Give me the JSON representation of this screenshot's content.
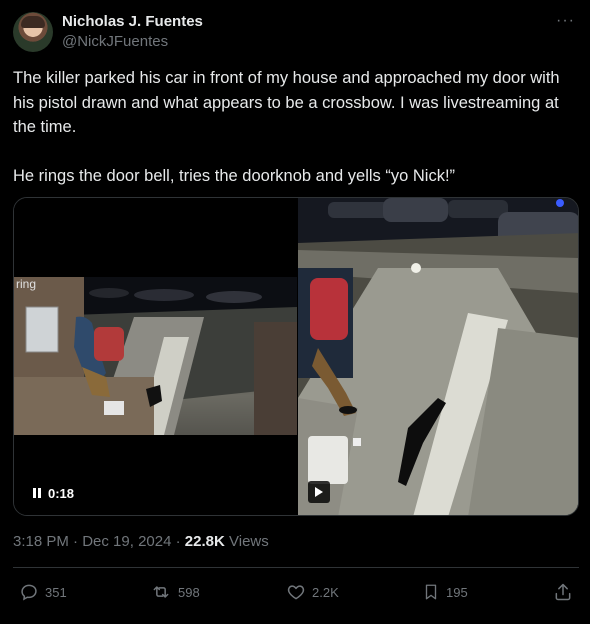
{
  "author": {
    "name": "Nicholas J. Fuentes",
    "handle": "@NickJFuentes",
    "more_icon": "more-dots-icon"
  },
  "tweet": {
    "paragraph_1": "The killer parked his car in front of my house and approached my door with his pistol drawn and what appears to be a crossbow. I was livestreaming at the time.",
    "paragraph_2": "He rings the door bell, tries the doorknob and yells “yo Nick!”"
  },
  "media": {
    "left_video": {
      "watermark": "ring",
      "duration": "0:18",
      "pause_icon": "pause-icon"
    },
    "right_video": {
      "play_icon": "play-icon"
    }
  },
  "meta": {
    "time": "3:18 PM",
    "separator": "·",
    "date": "Dec 19, 2024",
    "views_count": "22.8K",
    "views_label": "Views"
  },
  "actions": {
    "replies": "351",
    "reposts": "598",
    "likes": "2.2K",
    "bookmarks": "195"
  },
  "colors": {
    "background": "#000000",
    "text": "#e7e9ea",
    "muted": "#71767b",
    "border": "#2f3336"
  }
}
